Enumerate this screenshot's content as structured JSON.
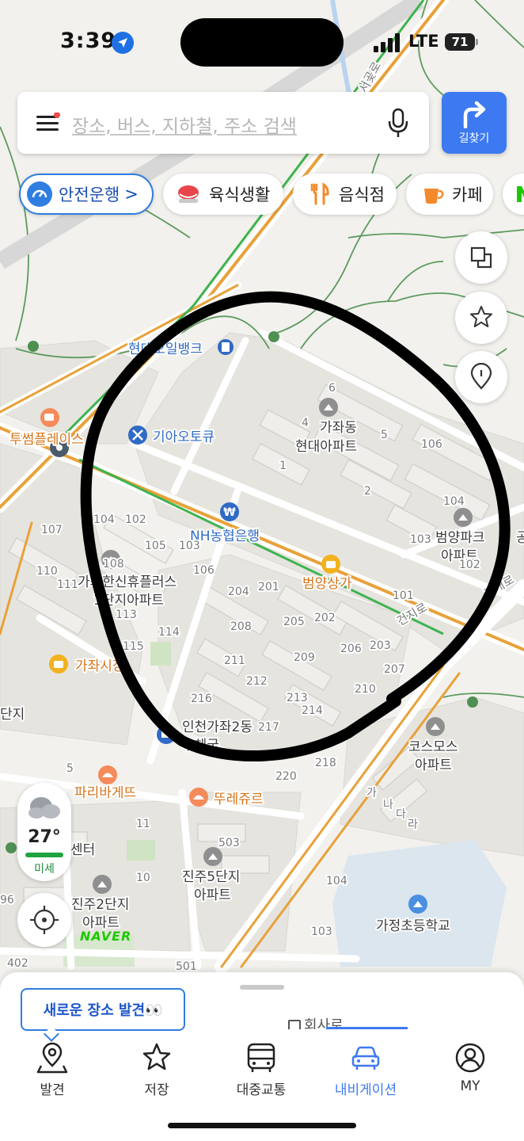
{
  "status_bar": {
    "time": "3:39",
    "network": "LTE",
    "battery": "71"
  },
  "search": {
    "placeholder": "장소, 버스, 지하철, 주소 검색"
  },
  "route_button": {
    "label": "길찾기"
  },
  "chips": [
    {
      "label": "안전운행",
      "suffix": ">"
    },
    {
      "label": "육식생활"
    },
    {
      "label": "음식점"
    },
    {
      "label": "카페"
    }
  ],
  "map": {
    "places": {
      "hyundai_oil": "현대오일뱅크",
      "twosome": "투썸플레이스",
      "kia": "기아오토큐",
      "gajwa_hyundai_1": "가좌동",
      "gajwa_hyundai_2": "현대아파트",
      "nh_bank": "NH농협은행",
      "beomyang_mall": "범양상가",
      "beomyang_park_1": "범양파크",
      "beomyang_park_2": "아파트",
      "gajwa_hanshin_1": "가좌한신휴플러스",
      "gajwa_hanshin_2": "1단지아파트",
      "gajwa_market": "가좌시장",
      "post_office_1": "인천가좌2동",
      "post_office_2": "우체국",
      "cosmos_1": "코스모스",
      "cosmos_2": "아파트",
      "paris": "파리바게뜨",
      "tous": "뚜레쥬르",
      "jinju5_1": "진주5단지",
      "jinju5_2": "아파트",
      "jinju2_1": "진주2단지",
      "jinju2_2": "아파트",
      "gajeong_school": "가정초등학교",
      "center_partial": "센터",
      "left_partial": "단지",
      "road_geonji": "건지로",
      "road_top": "서곶로",
      "road_right": "고개로",
      "right_partial": "공"
    },
    "building_numbers": [
      "6",
      "4",
      "5",
      "106",
      "1",
      "2",
      "104",
      "103",
      "102",
      "107",
      "104",
      "102",
      "105",
      "103",
      "108",
      "110",
      "111",
      "106",
      "113",
      "204",
      "201",
      "202",
      "205",
      "101",
      "208",
      "206",
      "203",
      "209",
      "207",
      "115",
      "114",
      "211",
      "212",
      "213",
      "210",
      "214",
      "216",
      "217",
      "218",
      "220",
      "5",
      "11",
      "10",
      "503",
      "104",
      "103",
      "402",
      "501",
      "96",
      "가",
      "나",
      "다",
      "라"
    ]
  },
  "annotation": {
    "shape": "hand-drawn circle around Gajwa-dong area",
    "color": "#000000"
  },
  "weather": {
    "temp": "27°",
    "dust": "미세"
  },
  "brand": "NAVER",
  "sheet": {
    "peek_text": "회사로",
    "tooltip": "새로운 장소 발견👀"
  },
  "tabs": [
    {
      "label": "발견",
      "icon": "map-pin-icon",
      "active": false
    },
    {
      "label": "저장",
      "icon": "star-icon",
      "active": false
    },
    {
      "label": "대중교통",
      "icon": "bus-icon",
      "active": false
    },
    {
      "label": "내비게이션",
      "icon": "car-icon",
      "active": true
    },
    {
      "label": "MY",
      "icon": "user-icon",
      "active": false
    }
  ],
  "colors": {
    "accent": "#3d7af2",
    "road_orange": "#e8a13a",
    "rail_green": "#3eb34f",
    "trail_green": "#4e8f52"
  }
}
